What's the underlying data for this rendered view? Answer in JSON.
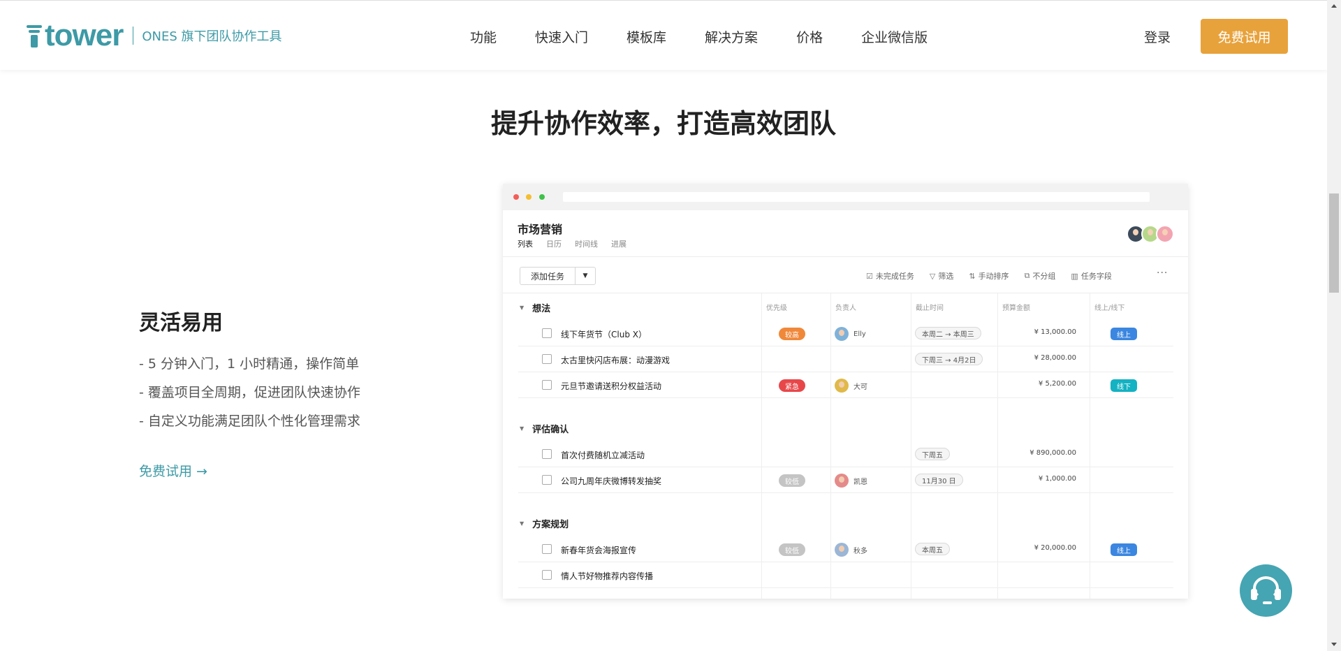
{
  "header": {
    "brand": "tower",
    "tagline": "ONES 旗下团队协作工具",
    "nav": [
      "功能",
      "快速入门",
      "模板库",
      "解决方案",
      "价格",
      "企业微信版"
    ],
    "login": "登录",
    "trial": "免费试用"
  },
  "headline": "提升协作效率，打造高效团队",
  "feature": {
    "title": "灵活易用",
    "points": [
      "- 5 分钟入门，1 小时精通，操作简单",
      "- 覆盖项目全周期，促进团队快速协作",
      "- 自定义功能满足团队个性化管理需求"
    ],
    "link": "免费试用 →"
  },
  "app": {
    "project_title": "市场营销",
    "views": [
      "列表",
      "日历",
      "时间线",
      "进展"
    ],
    "active_view": "列表",
    "add_task": "添加任务",
    "toolbar": [
      {
        "icon": "checkbox-icon",
        "glyph": "☑",
        "label": "未完成任务"
      },
      {
        "icon": "filter-icon",
        "glyph": "▽",
        "label": "筛选"
      },
      {
        "icon": "sort-icon",
        "glyph": "⇅",
        "label": "手动排序"
      },
      {
        "icon": "group-icon",
        "glyph": "⧉",
        "label": "不分组"
      },
      {
        "icon": "fields-icon",
        "glyph": "▥",
        "label": "任务字段"
      }
    ],
    "more": "···",
    "columns": [
      "优先级",
      "负责人",
      "截止时间",
      "预算金额",
      "线上/线下"
    ],
    "colors": {
      "priority_high": "#f0883a",
      "priority_urgent": "#e8474a",
      "priority_low": "#c4c4c4",
      "online": "#3b86e0",
      "offline": "#14b2c2"
    },
    "groups": [
      {
        "name": "想法",
        "tasks": [
          {
            "name": "线下年货节（Club X）",
            "priority": "较高",
            "priority_color": "#f0883a",
            "owner": "Elly",
            "owner_color": "#7fb2d9",
            "date": "本周二 → 本周三",
            "amount": "¥ 13,000.00",
            "channel": "线上",
            "channel_color": "#3b86e0"
          },
          {
            "name": "太古里快闪店布展：动漫游戏",
            "priority": "",
            "priority_color": "",
            "owner": "",
            "owner_color": "",
            "date": "下周三 → 4月2日",
            "amount": "¥ 28,000.00",
            "channel": "",
            "channel_color": ""
          },
          {
            "name": "元旦节邀请送积分权益活动",
            "priority": "紧急",
            "priority_color": "#e8474a",
            "owner": "大可",
            "owner_color": "#e0b94a",
            "date": "",
            "amount": "¥ 5,200.00",
            "channel": "线下",
            "channel_color": "#14b2c2"
          }
        ]
      },
      {
        "name": "评估确认",
        "tasks": [
          {
            "name": "首次付费随机立减活动",
            "priority": "",
            "priority_color": "",
            "owner": "",
            "owner_color": "",
            "date": "下周五",
            "amount": "¥ 890,000.00",
            "channel": "",
            "channel_color": ""
          },
          {
            "name": "公司九周年庆微博转发抽奖",
            "priority": "较低",
            "priority_color": "#c4c4c4",
            "owner": "凯恩",
            "owner_color": "#e58a8a",
            "date": "11月30 日",
            "amount": "¥ 1,000.00",
            "channel": "",
            "channel_color": ""
          }
        ]
      },
      {
        "name": "方案规划",
        "tasks": [
          {
            "name": "新春年货会海报宣传",
            "priority": "较低",
            "priority_color": "#c4c4c4",
            "owner": "秋多",
            "owner_color": "#9bb6d6",
            "date": "本周五",
            "amount": "¥ 20,000.00",
            "channel": "线上",
            "channel_color": "#3b86e0"
          },
          {
            "name": "情人节好物推荐内容传播",
            "priority": "",
            "priority_color": "",
            "owner": "",
            "owner_color": "",
            "date": "",
            "amount": "",
            "channel": "",
            "channel_color": ""
          }
        ]
      }
    ]
  }
}
